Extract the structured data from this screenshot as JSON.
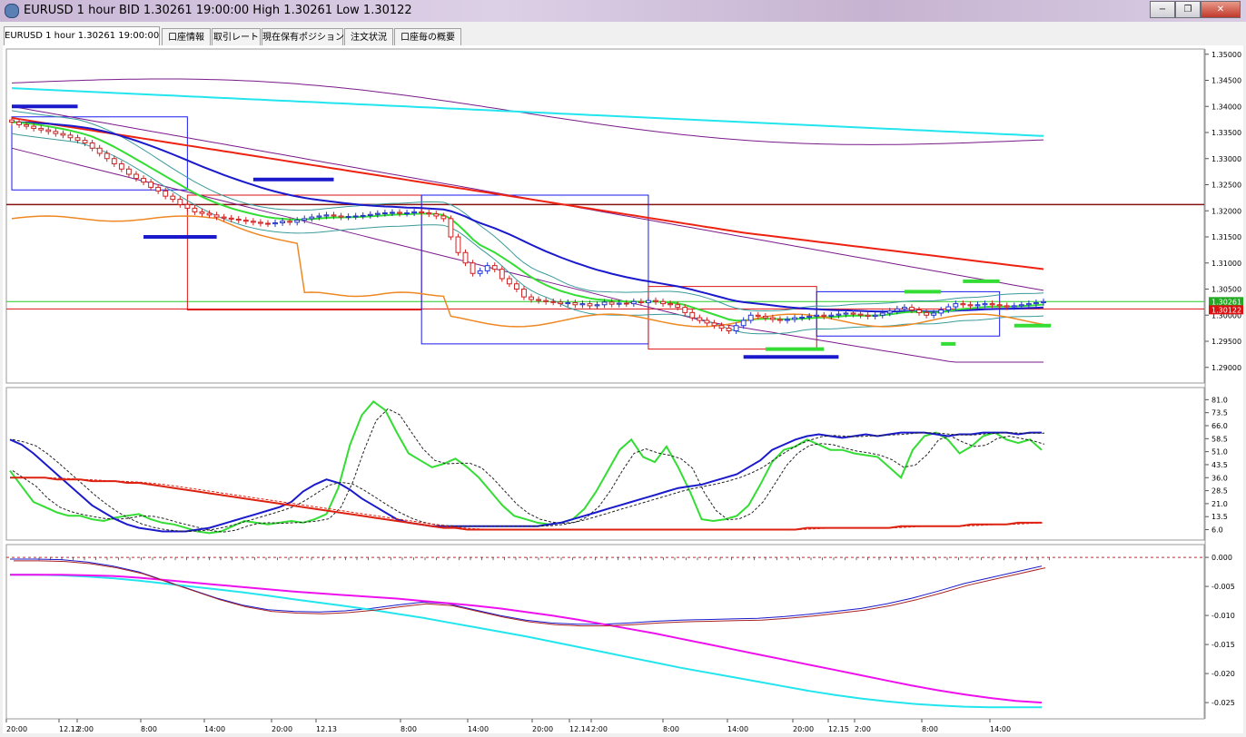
{
  "window": {
    "title": "EURUSD 1 hour BID 1.30261 19:00:00 High 1.30261 Low 1.30122",
    "minimize_label": "−",
    "maximize_label": "❐",
    "close_label": "✕"
  },
  "tabs": [
    {
      "label": "EURUSD 1 hour 1.30261 19:00:00",
      "active": true
    },
    {
      "label": "口座情報",
      "active": false
    },
    {
      "label": "取引レート",
      "active": false
    },
    {
      "label": "現在保有ポジション",
      "active": false
    },
    {
      "label": "注文状況",
      "active": false
    },
    {
      "label": "口座毎の概要",
      "active": false
    }
  ],
  "colors": {
    "up_candle": "#2233cc",
    "down_candle": "#cc2222",
    "ma_fast": "#33dd33",
    "ma_mid": "#1a1acc",
    "ma_slow": "#ee2211",
    "ma_long": "#22e5ee",
    "bollinger": "#7a1a8a",
    "envelope": "#3a9a9a",
    "orange_line": "#ee8822",
    "box_blue": "#1a1aee",
    "box_red": "#dd1111",
    "dark_red_line": "#881111",
    "green_hline": "#22cc22",
    "osc_green": "#33dd33",
    "osc_blue": "#1a1acc",
    "osc_red": "#dd2211",
    "macd_magenta": "#ee11ee",
    "macd_cyan": "#22e5ee",
    "zero_line": "#dd2222"
  },
  "chart_data": [
    {
      "type": "candlestick",
      "symbol": "EURUSD",
      "timeframe": "1 hour",
      "ylim": [
        1.287,
        1.351
      ],
      "y_ticks": [
        "1.35000",
        "1.34500",
        "1.34000",
        "1.33500",
        "1.33000",
        "1.32500",
        "1.32000",
        "1.31500",
        "1.31000",
        "1.30500",
        "1.30000",
        "1.29500",
        "1.29000"
      ],
      "last_price_label": "1.30261",
      "bid_label": "1.30122",
      "close": [
        1.337,
        1.3365,
        1.3362,
        1.3358,
        1.3355,
        1.3352,
        1.3348,
        1.3345,
        1.334,
        1.3335,
        1.333,
        1.332,
        1.331,
        1.33,
        1.329,
        1.328,
        1.327,
        1.3262,
        1.3255,
        1.3245,
        1.3238,
        1.3228,
        1.3222,
        1.3212,
        1.3205,
        1.3198,
        1.3195,
        1.3192,
        1.3188,
        1.3186,
        1.3184,
        1.3182,
        1.318,
        1.3178,
        1.3176,
        1.3175,
        1.3177,
        1.318,
        1.3178,
        1.3182,
        1.3185,
        1.3188,
        1.319,
        1.3192,
        1.319,
        1.3188,
        1.3189,
        1.319,
        1.3191,
        1.3193,
        1.3195,
        1.3196,
        1.3197,
        1.3195,
        1.3196,
        1.3198,
        1.3196,
        1.3194,
        1.319,
        1.3185,
        1.315,
        1.312,
        1.31,
        1.308,
        1.3085,
        1.3095,
        1.3088,
        1.307,
        1.306,
        1.305,
        1.3035,
        1.303,
        1.3028,
        1.3026,
        1.3025,
        1.3022,
        1.3024,
        1.302,
        1.3022,
        1.3018,
        1.302,
        1.3025,
        1.3021,
        1.3023,
        1.3022,
        1.3026,
        1.3024,
        1.3028,
        1.3026,
        1.3022,
        1.302,
        1.3015,
        1.3005,
        1.2995,
        1.299,
        1.2985,
        1.298,
        1.2975,
        1.297,
        1.298,
        1.299,
        1.3,
        1.2998,
        1.2995,
        1.2992,
        1.299,
        1.2992,
        1.2995,
        1.2996,
        1.2998,
        1.3,
        1.2998,
        1.3,
        1.3002,
        1.3004,
        1.3002,
        1.3,
        1.2998,
        1.3,
        1.3004,
        1.3008,
        1.3012,
        1.3015,
        1.301,
        1.3005,
        1.3,
        1.3004,
        1.301,
        1.3016,
        1.3022,
        1.302,
        1.3018,
        1.302,
        1.3022,
        1.302,
        1.3018,
        1.3016,
        1.3018,
        1.302,
        1.3022,
        1.3024,
        1.3026
      ]
    },
    {
      "type": "line",
      "name": "oscillator",
      "ylim": [
        0,
        88
      ],
      "y_ticks": [
        "81.0",
        "73.5",
        "66.0",
        "58.5",
        "51.0",
        "43.5",
        "36.0",
        "28.5",
        "21.0",
        "13.5",
        "6.0"
      ],
      "series": [
        {
          "name": "",
          "values": [
            40,
            31,
            22,
            19,
            16,
            14,
            14,
            12,
            11,
            13,
            14,
            15,
            12,
            10,
            9,
            7,
            5,
            4,
            5,
            8,
            11,
            10,
            9,
            10,
            11,
            10,
            12,
            15,
            30,
            55,
            72,
            80,
            75,
            62,
            50,
            46,
            42,
            44,
            47,
            42,
            36,
            28,
            20,
            14,
            12,
            10,
            9,
            10,
            12,
            18,
            28,
            40,
            52,
            58,
            48,
            45,
            54,
            42,
            28,
            12,
            11,
            12,
            14,
            20,
            32,
            45,
            52,
            54,
            58,
            55,
            52,
            52,
            50,
            49,
            48,
            42,
            36,
            52,
            60,
            62,
            58,
            50,
            54,
            60,
            62,
            58,
            56,
            58,
            52
          ]
        },
        {
          "name": "",
          "values": [
            58,
            55,
            50,
            44,
            38,
            32,
            26,
            20,
            16,
            12,
            9,
            7,
            6,
            5,
            5,
            5,
            6,
            7,
            9,
            11,
            13,
            15,
            17,
            19,
            22,
            28,
            32,
            35,
            33,
            29,
            24,
            20,
            16,
            12,
            10,
            9,
            8,
            8,
            8,
            8,
            8,
            8,
            8,
            8,
            8,
            8,
            9,
            10,
            12,
            14,
            16,
            18,
            20,
            22,
            24,
            26,
            28,
            30,
            31,
            32,
            34,
            36,
            38,
            42,
            46,
            52,
            55,
            58,
            60,
            61,
            60,
            59,
            60,
            61,
            60,
            61,
            62,
            62,
            62,
            61,
            60,
            61,
            61,
            62,
            62,
            62,
            61,
            62,
            62
          ]
        },
        {
          "name": "",
          "values": [
            36,
            36,
            36,
            36,
            35,
            35,
            35,
            34,
            34,
            34,
            33,
            33,
            32,
            31,
            30,
            29,
            28,
            27,
            26,
            25,
            24,
            23,
            22,
            21,
            20,
            19,
            18,
            17,
            16,
            15,
            14,
            13,
            12,
            11,
            10,
            9,
            8,
            7,
            7,
            6,
            6,
            6,
            6,
            6,
            6,
            6,
            6,
            6,
            6,
            6,
            6,
            6,
            6,
            6,
            6,
            6,
            6,
            6,
            6,
            6,
            6,
            6,
            6,
            6,
            6,
            6,
            6,
            6,
            7,
            7,
            7,
            7,
            7,
            7,
            7,
            7,
            8,
            8,
            8,
            8,
            8,
            8,
            9,
            9,
            9,
            9,
            10,
            10,
            10
          ]
        }
      ]
    },
    {
      "type": "line",
      "name": "macd",
      "ylim": [
        -0.0278,
        0.0022
      ],
      "y_ticks": [
        "0.000",
        "-0.005",
        "-0.010",
        "-0.015",
        "-0.020",
        "-0.025"
      ],
      "series": [
        {
          "name": "",
          "values": [
            -0.0003,
            -0.0003,
            -0.0004,
            -0.0008,
            -0.0015,
            -0.0025,
            -0.004,
            -0.0055,
            -0.007,
            -0.0082,
            -0.009,
            -0.0093,
            -0.0094,
            -0.0092,
            -0.0088,
            -0.0082,
            -0.0077,
            -0.008,
            -0.009,
            -0.01,
            -0.0108,
            -0.0113,
            -0.0115,
            -0.0115,
            -0.0113,
            -0.011,
            -0.0108,
            -0.0107,
            -0.0106,
            -0.0105,
            -0.0102,
            -0.0098,
            -0.0093,
            -0.0088,
            -0.008,
            -0.007,
            -0.0058,
            -0.0045,
            -0.0035,
            -0.0025,
            -0.0015
          ]
        },
        {
          "name": "",
          "values": [
            -0.003,
            -0.003,
            -0.0031,
            -0.0033,
            -0.0036,
            -0.004,
            -0.0045,
            -0.005,
            -0.0055,
            -0.006,
            -0.0066,
            -0.0072,
            -0.0078,
            -0.0084,
            -0.009,
            -0.0097,
            -0.0104,
            -0.0112,
            -0.012,
            -0.0128,
            -0.0136,
            -0.0145,
            -0.0154,
            -0.0163,
            -0.0172,
            -0.0181,
            -0.019,
            -0.0198,
            -0.0206,
            -0.0214,
            -0.0222,
            -0.023,
            -0.0237,
            -0.0243,
            -0.0248,
            -0.0252,
            -0.0255,
            -0.0257,
            -0.0258,
            -0.0258,
            -0.0258
          ]
        },
        {
          "name": "",
          "values": [
            -0.003,
            -0.003,
            -0.003,
            -0.0031,
            -0.0032,
            -0.0035,
            -0.0039,
            -0.0043,
            -0.0047,
            -0.0051,
            -0.0055,
            -0.0059,
            -0.0062,
            -0.0065,
            -0.0068,
            -0.0071,
            -0.0075,
            -0.0079,
            -0.0083,
            -0.0088,
            -0.0094,
            -0.01,
            -0.0107,
            -0.0115,
            -0.0123,
            -0.0131,
            -0.014,
            -0.0149,
            -0.0158,
            -0.0167,
            -0.0176,
            -0.0185,
            -0.0194,
            -0.0203,
            -0.0212,
            -0.0221,
            -0.0229,
            -0.0236,
            -0.0242,
            -0.0247,
            -0.025
          ]
        }
      ]
    }
  ],
  "x_ticks": [
    "20:00",
    "12.12",
    "2:00",
    "8:00",
    "14:00",
    "20:00",
    "12.13",
    "8:00",
    "14:00",
    "20:00",
    "12.14",
    "2:00",
    "8:00",
    "14:00",
    "20:00",
    "12.15",
    "2:00",
    "8:00",
    "14:00"
  ]
}
